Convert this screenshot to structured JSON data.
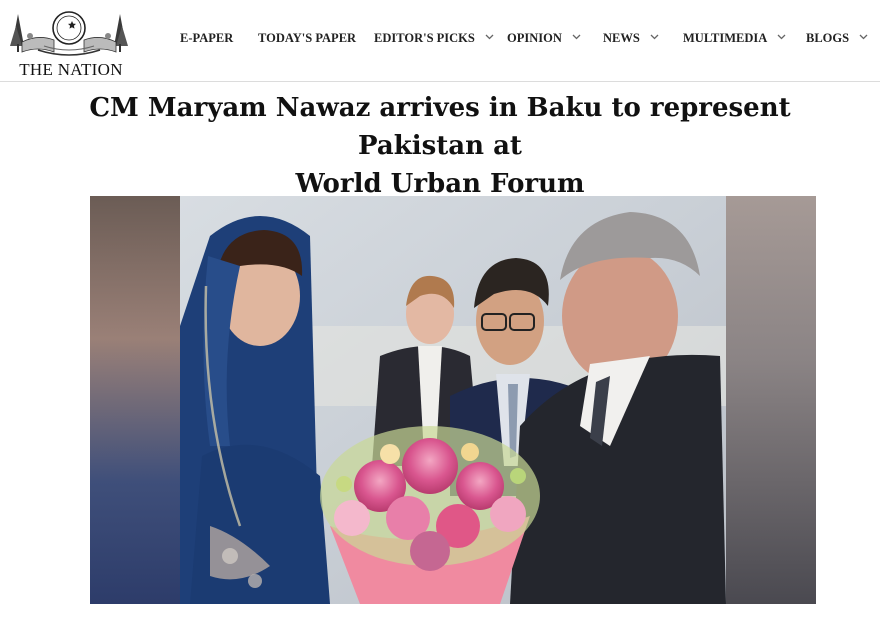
{
  "brand": {
    "name": "THE NATION"
  },
  "nav": [
    {
      "label": "E-PAPER",
      "dropdown": false
    },
    {
      "label": "TODAY'S PAPER",
      "dropdown": false
    },
    {
      "label": "EDITOR'S PICKS",
      "dropdown": true
    },
    {
      "label": "OPINION",
      "dropdown": true
    },
    {
      "label": "NEWS",
      "dropdown": true
    },
    {
      "label": "MULTIMEDIA",
      "dropdown": true
    },
    {
      "label": "BLOGS",
      "dropdown": true
    }
  ],
  "article": {
    "headline_line1": "CM Maryam Nawaz arrives in Baku to represent Pakistan at",
    "headline_line2": "World Urban Forum"
  },
  "colors": {
    "nav_text": "#222222",
    "header_border": "#dcdcdc",
    "headline": "#111111"
  }
}
